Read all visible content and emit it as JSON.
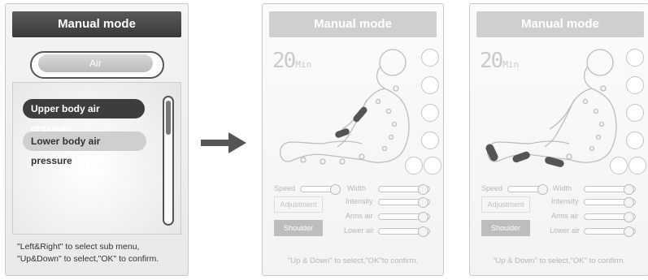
{
  "left_screen": {
    "title": "Manual mode",
    "sub_menu": "Air",
    "options": [
      "Upper body air pressure",
      "Lower body air pressure"
    ],
    "help_lines": [
      "\"Left&Right\" to select sub menu,",
      "\"Up&Down\" to select,\"OK\" to confirm."
    ]
  },
  "middle_screen": {
    "title": "Manual mode",
    "timer_value": "20",
    "timer_unit": "Min",
    "labels": {
      "speed": "Speed",
      "width": "Width",
      "intensity": "Intensity",
      "arms_air": "Arms air",
      "lower_air": "Lower air",
      "adjustment": "Adjustment",
      "shoulder": "Shoulder"
    },
    "footer": "\"Up & Down\" to select,\"OK\"to confirm.",
    "highlighted_zone": "upper body"
  },
  "right_screen": {
    "title": "Manual mode",
    "timer_value": "20",
    "timer_unit": "Min",
    "labels": {
      "speed": "Speed",
      "width": "Width",
      "intensity": "Intensity",
      "arms_air": "Arms air",
      "lower_air": "Lower air",
      "adjustment": "Adjustment",
      "shoulder": "Shoulder"
    },
    "footer": "\"Up & Down\" to select,\"OK\" to confirm.",
    "highlighted_zone": "lower body"
  },
  "colors": {
    "active": "#3d3d3d",
    "disabled": "#cfcfcf",
    "accent_shape": "#555555"
  },
  "icons": [
    "right-arrow-icon",
    "body-figure-icon"
  ]
}
